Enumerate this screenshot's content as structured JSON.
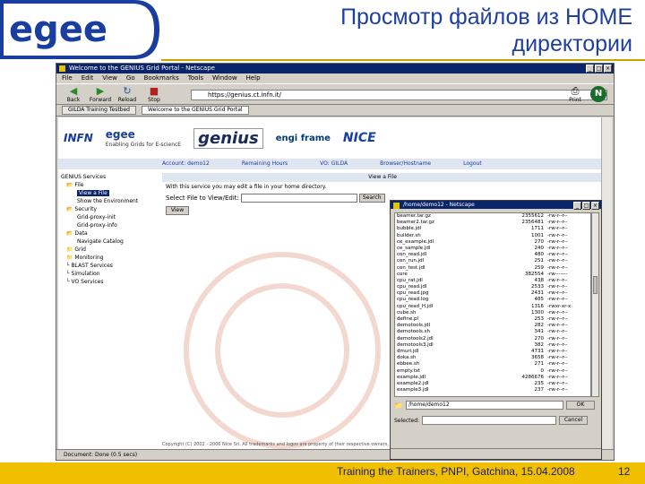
{
  "slide": {
    "title_line1": "Просмотр файлов из HOME",
    "title_line2": "директории",
    "footer": "Training the Trainers, PNPI, Gatchina, 15.04.2008",
    "page_number": "12",
    "logo_text": "egee",
    "colors": {
      "title": "#1f3fa0",
      "footer_bg": "#f0c000",
      "logo_blue": "#1a3ea0"
    }
  },
  "browser": {
    "window_title": "Welcome to the GENIUS Grid Portal - Netscape",
    "menu": [
      "File",
      "Edit",
      "View",
      "Go",
      "Bookmarks",
      "Tools",
      "Window",
      "Help"
    ],
    "nav": {
      "back": "Back",
      "forward": "Forward",
      "reload": "Reload",
      "stop": "Stop",
      "print": "Print"
    },
    "address_label": "",
    "address": "https://genius.ct.infn.it/",
    "tabs": [
      "GILDA Training Testbed",
      "Welcome to the GENIUS Grid Portal"
    ],
    "status": "Document: Done (0.5 secs)"
  },
  "portal": {
    "logos": {
      "infn": "INFN",
      "egee": "egee",
      "egee_sub": "Enabling Grids for E-sciencE",
      "genius": "genius",
      "enginframe": "engi frame",
      "nice": "NICE"
    },
    "genbar": [
      "Account: demo12",
      "Remaining Hours",
      "VO: GILDA",
      "Browser/Hostname",
      "Logout"
    ],
    "sidebar": [
      "GENIUS Services",
      "File",
      "View a File",
      "Show the Environment",
      "Security",
      "Grid-proxy-init",
      "Grid-proxy-info",
      "Data",
      "Navigate Catalog",
      "Grid",
      "Monitoring",
      "BLAST Services",
      "Simulation",
      "VO Services"
    ],
    "view_header": "View a File",
    "content_text": "With this service you may edit a file in your home directory.",
    "select_label": "Select File to View/Edit:",
    "search_button": "Search",
    "view_button": "View",
    "copyright": "Copyright (C) 2002 - 2006 Nice Srl. All trademarks and logos are property of their respective owners."
  },
  "popup": {
    "title": "/home/demo12 - Netscape",
    "files": [
      {
        "name": "beamer.tar.gz",
        "size": "2355612",
        "perm": "-rw-r--r--"
      },
      {
        "name": "beamer2.tar.gz",
        "size": "2356481",
        "perm": "-rw-r--r--"
      },
      {
        "name": "bubble.jdl",
        "size": "1711",
        "perm": "-rw-r--r--"
      },
      {
        "name": "builder.sh",
        "size": "1001",
        "perm": "-rw-r--r--"
      },
      {
        "name": "ce_example.jdl",
        "size": "270",
        "perm": "-rw-r--r--"
      },
      {
        "name": "ce_sample.jdl",
        "size": "240",
        "perm": "-rw-r--r--"
      },
      {
        "name": "con_read.jdl",
        "size": "480",
        "perm": "-rw-r--r--"
      },
      {
        "name": "con_run.jdl",
        "size": "251",
        "perm": "-rw-r--r--"
      },
      {
        "name": "con_test.jdl",
        "size": "259",
        "perm": "-rw-r--r--"
      },
      {
        "name": "core",
        "size": "382554",
        "perm": "-rw-------"
      },
      {
        "name": "cpu_rat.jdl",
        "size": "438",
        "perm": "-rw-r--r--"
      },
      {
        "name": "cpu_read.jdl",
        "size": "2533",
        "perm": "-rw-r--r--"
      },
      {
        "name": "cpu_read.jpg",
        "size": "2431",
        "perm": "-rw-r--r--"
      },
      {
        "name": "cpu_read.log",
        "size": "485",
        "perm": "-rw-r--r--"
      },
      {
        "name": "cpu_read_H.jdl",
        "size": "1316",
        "perm": "-rwxr-xr-x"
      },
      {
        "name": "cube.sh",
        "size": "1300",
        "perm": "-rw-r--r--"
      },
      {
        "name": "define.pl",
        "size": "253",
        "perm": "-rw-r--r--"
      },
      {
        "name": "demotools.jdl",
        "size": "282",
        "perm": "-rw-r--r--"
      },
      {
        "name": "demotools.sh",
        "size": "341",
        "perm": "-rw-r--r--"
      },
      {
        "name": "demotools2.jdl",
        "size": "270",
        "perm": "-rw-r--r--"
      },
      {
        "name": "demotools3.jdl",
        "size": "382",
        "perm": "-rw-r--r--"
      },
      {
        "name": "dmuri.jdl",
        "size": "4731",
        "perm": "-rw-r--r--"
      },
      {
        "name": "doka.sh",
        "size": "3658",
        "perm": "-rw-r--r--"
      },
      {
        "name": "ebbee.sh",
        "size": "271",
        "perm": "-rw-r--r--"
      },
      {
        "name": "empty.txt",
        "size": "0",
        "perm": "-rw-r--r--"
      },
      {
        "name": "example.jdl",
        "size": "4286676",
        "perm": "-rw-r--r--"
      },
      {
        "name": "example2.jdl",
        "size": "235",
        "perm": "-rw-r--r--"
      },
      {
        "name": "example3.jdl",
        "size": "237",
        "perm": "-rw-r--r--"
      }
    ],
    "path_value": "/home/demo12",
    "ok_button": "OK",
    "selected_label": "Selected:",
    "clear_button": "Cancel"
  }
}
